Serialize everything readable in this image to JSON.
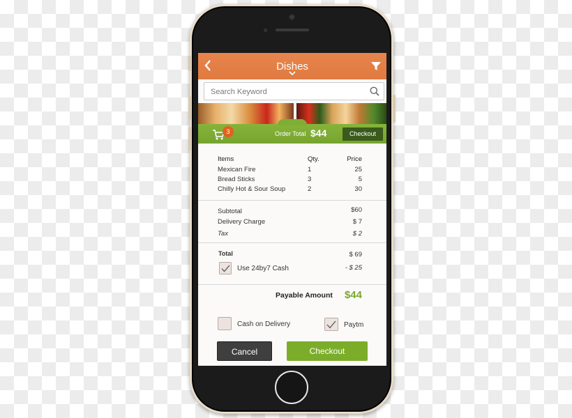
{
  "nav": {
    "title": "Dishes"
  },
  "search": {
    "placeholder": "Search Keyword"
  },
  "order_bar": {
    "cart_count": "3",
    "order_total_label": "Order Total",
    "order_total_value": "$44",
    "checkout_label": "Checkout"
  },
  "receipt": {
    "headers": {
      "items": "Items",
      "qty": "Qty.",
      "price": "Price"
    },
    "rows": [
      {
        "item": "Mexican Fire",
        "qty": "1",
        "price": "25"
      },
      {
        "item": "Bread Sticks",
        "qty": "3",
        "price": "5"
      },
      {
        "item": "Chilly Hot & Sour Soup",
        "qty": "2",
        "price": "30"
      }
    ],
    "subtotal_label": "Subtotal",
    "subtotal_value": "$60",
    "delivery_label": "Delivery Charge",
    "delivery_value": "$ 7",
    "tax_label": "Tax",
    "tax_value": "$ 2",
    "total_label": "Total",
    "total_value": "$ 69",
    "cash_label": "Use 24by7 Cash",
    "cash_value": "- $ 25",
    "cash_checked": true,
    "payable_label": "Payable Amount",
    "payable_value": "$44",
    "cod_label": "Cash on Delivery",
    "cod_checked": false,
    "paytm_label": "Paytm",
    "paytm_checked": true
  },
  "buttons": {
    "cancel": "Cancel",
    "checkout": "Checkout"
  },
  "colors": {
    "nav": "#e07c42",
    "order_bar": "#7fae35",
    "checkout_button": "#7cad2a",
    "cancel_button": "#3f3f3f",
    "payable_value": "#7aa82e",
    "badge": "#e0621f"
  },
  "icons": {
    "back": "chevron-left-icon",
    "title_dropdown": "chevron-down-icon",
    "filter": "filter-icon",
    "search": "search-icon",
    "cart": "cart-icon",
    "check": "checkmark-icon"
  }
}
